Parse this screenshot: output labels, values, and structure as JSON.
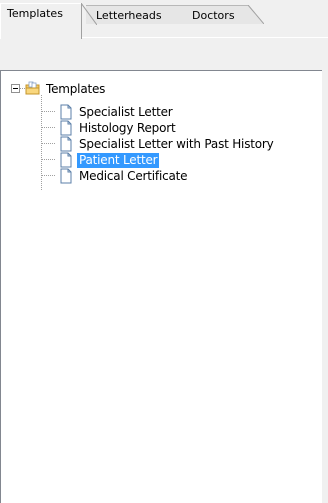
{
  "tabs": [
    {
      "label": "Templates",
      "active": true
    },
    {
      "label": "Letterheads",
      "active": false
    },
    {
      "label": "Doctors",
      "active": false
    }
  ],
  "tree": {
    "root": {
      "label": "Templates",
      "icon": "folder-icon",
      "expanded": true
    },
    "items": [
      {
        "label": "Specialist Letter",
        "icon": "document-icon",
        "selected": false
      },
      {
        "label": "Histology Report",
        "icon": "document-icon",
        "selected": false
      },
      {
        "label": "Specialist Letter with Past History",
        "icon": "document-icon",
        "selected": false
      },
      {
        "label": "Patient Letter",
        "icon": "document-icon",
        "selected": true
      },
      {
        "label": "Medical Certificate",
        "icon": "document-icon",
        "selected": false
      }
    ]
  },
  "colors": {
    "selection": "#3399ff",
    "tree_background": "#ffffff",
    "window_background": "#f0f0f0"
  }
}
